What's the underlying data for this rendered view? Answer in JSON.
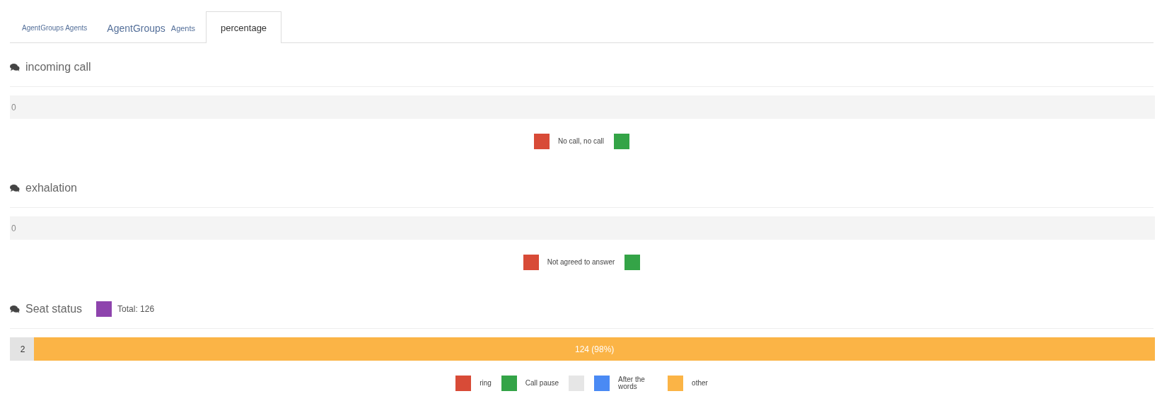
{
  "tabs": [
    {
      "kind": "plain",
      "label": "AgentGroups Agents",
      "selected": false
    },
    {
      "kind": "split",
      "label": "AgentGroups",
      "sublabel": "Agents",
      "selected": false
    },
    {
      "kind": "plain",
      "label": "percentage",
      "selected": true
    }
  ],
  "sections": [
    {
      "title": "incoming call",
      "segments": [
        {
          "label": "0",
          "color": "#f4f4f4",
          "kind": "empty",
          "level": 1
        }
      ],
      "legend": [
        {
          "label": "No call, no call",
          "color": "#d84b37"
        },
        {
          "color": "#34a447"
        }
      ]
    },
    {
      "title": "exhalation",
      "segments": [
        {
          "label": "0",
          "color": "#f4f4f4",
          "kind": "empty",
          "level": 1
        }
      ],
      "legend": [
        {
          "label": "Not agreed to answer",
          "color": "#d84b37"
        },
        {
          "color": "#34a447"
        }
      ]
    },
    {
      "title": "Seat status",
      "badge": {
        "label": "Total: 126",
        "color": "#8e44ad"
      },
      "segments": [
        {
          "label": "2",
          "color": "#e3e3e3",
          "kind": "rest",
          "level": 0.02
        },
        {
          "label": "124 (98%)",
          "color": "#fbb446",
          "kind": "fill",
          "level": 0.98
        }
      ],
      "legend": [
        {
          "label": "ring",
          "color": "#d84b37"
        },
        {
          "label": "Call pause",
          "color": "#34a447"
        },
        {
          "color": "#e6e6e6"
        },
        {
          "label": "After the words",
          "color": "#4a8af4"
        },
        {
          "label": "other",
          "color": "#fbb446"
        }
      ]
    }
  ]
}
